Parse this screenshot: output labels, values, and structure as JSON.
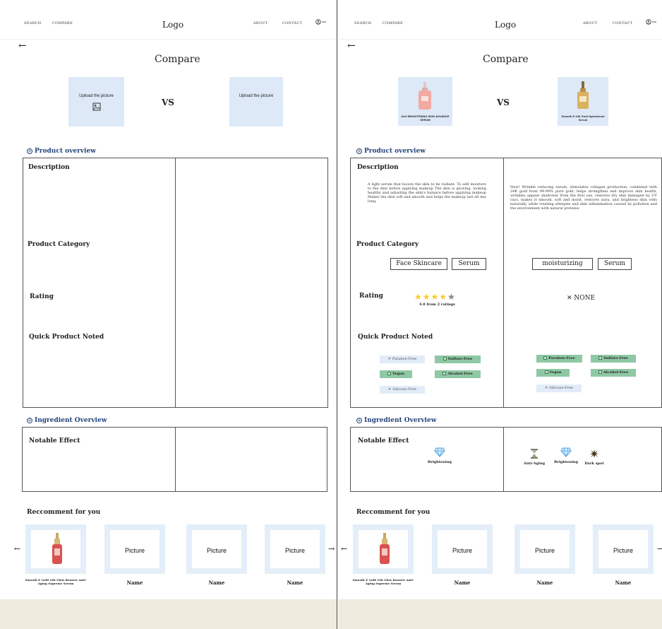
{
  "nav": {
    "search": "SEARCH",
    "compare": "COMPARE",
    "logo": "Logo",
    "about": "ABOUT",
    "contact": "CONTACT"
  },
  "icons": {
    "back": "arrow-left-icon",
    "user": "user-circle-icon",
    "picture": "image-icon",
    "expand": "plus-circle-icon",
    "check": "check-box-icon",
    "cross": "cross-icon",
    "star": "star-icon",
    "diamond": "diamond-icon",
    "hourglass": "hourglass-icon",
    "splat": "splat-icon"
  },
  "colors": {
    "section_heading": "#24457c",
    "upload_bg": "#dde9f7",
    "tag_on": "#8fc8a4",
    "tag_off": "#e2ecf8",
    "star": "#f5cc2a",
    "footer": "#efebdf"
  },
  "page_title": "Compare",
  "vs": "VS",
  "sections": {
    "product_overview": "Product overview",
    "ingredient_overview": "Ingredient Overview",
    "recommend": "Reccomment for you"
  },
  "labels": {
    "description": "Description",
    "category": "Product Category",
    "rating": "Rating",
    "quick": "Quick Product Noted",
    "notable": "Notable Effect"
  },
  "left": {
    "upload_1": "Upload the picture",
    "upload_2": "Upload the picture",
    "effect": "Brightening"
  },
  "right": {
    "product_1": {
      "name": "AU2 BRIGHTENING SKIN ADVANCE SERUM",
      "description": "A light serum that boosts the skin to be radiant. To add moisture to the skin before applying makeup The skin is glowing, looking healthy and adjusting the skin's balance before applying makeup Makes the skin soft and smooth and helps the makeup last all day long.",
      "categories": [
        "Face Skincare",
        "Serum"
      ],
      "rating": 4.0,
      "rating_text": "4.0 from 2 ratings",
      "tags": [
        {
          "label": "Paraben-Free",
          "on": false
        },
        {
          "label": "Sulfate-Free",
          "on": true
        },
        {
          "label": "Vegan",
          "on": true
        },
        {
          "label": "Alcohol-Free",
          "on": true
        },
        {
          "label": "Silicone-Free",
          "on": false
        }
      ],
      "effect": "Brightening"
    },
    "product_2": {
      "name": "Smooth E 24K Gold Hydroboost Serum",
      "description": "New! Wrinkle reducing serum, stimulates collagen production, combined with 24K gold from 99.99% pure gold, helps strengthen and improve skin health, wrinkles appear shallower from the first use, restores dry skin damaged by UV rays, makes it smooth, soft and moist, restores aura, and brightens skin cells naturally, while treating allergies and skin inflammation caused by pollution and the environment with natural proteins.",
      "categories": [
        "moisturizing",
        "Serum"
      ],
      "rating_text": "NONE",
      "tags": [
        {
          "label": "Paraben-Free",
          "on": true
        },
        {
          "label": "Sulfate-Free",
          "on": true
        },
        {
          "label": "Vegan",
          "on": true
        },
        {
          "label": "Alcohol-Free",
          "on": true
        },
        {
          "label": "Silicone-Free",
          "on": false
        }
      ],
      "effects": [
        "Anti-Aging",
        "Brightening",
        "Dark spot"
      ]
    }
  },
  "recommend": [
    {
      "name": "Smooth E Gold 24k Glow Booster Anti-Aging Supreme Serum",
      "picture": ""
    },
    {
      "name": "Name",
      "picture": "Picture"
    },
    {
      "name": "Name",
      "picture": "Picture"
    },
    {
      "name": "Name",
      "picture": "Picture"
    }
  ]
}
